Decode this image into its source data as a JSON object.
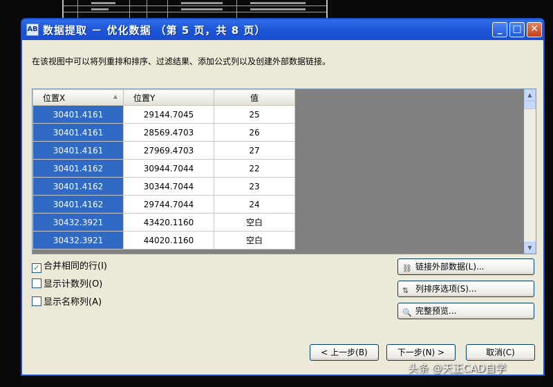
{
  "window": {
    "title": "数据提取 － 优化数据 （第 5 页，共 8 页）",
    "min_glyph": "_",
    "max_glyph": "□",
    "close_glyph": "✕"
  },
  "description": "在该视图中可以将列重排和排序、过滤结果、添加公式列以及创建外部数据链接。",
  "table": {
    "headers": [
      "位置X",
      "位置Y",
      "值"
    ],
    "rows": [
      [
        "30401.4161",
        "29144.7045",
        "25"
      ],
      [
        "30401.4161",
        "28569.4703",
        "26"
      ],
      [
        "30401.4161",
        "27969.4703",
        "27"
      ],
      [
        "30401.4162",
        "30944.7044",
        "22"
      ],
      [
        "30401.4162",
        "30344.7044",
        "23"
      ],
      [
        "30401.4162",
        "29744.7044",
        "24"
      ],
      [
        "30432.3921",
        "43420.1160",
        "空白"
      ],
      [
        "30432.3921",
        "44020.1160",
        "空白"
      ]
    ]
  },
  "options": {
    "merge_rows": {
      "label": "合并相同的行(I)",
      "checked": true
    },
    "show_count": {
      "label": "显示计数列(O)",
      "checked": false
    },
    "show_name": {
      "label": "显示名称列(A)",
      "checked": false
    }
  },
  "buttons": {
    "link_external": "链接外部数据(L)...",
    "sort_options": "列排序选项(S)...",
    "full_preview": "完整预览...",
    "prev": "< 上一步(B)",
    "next": "下一步(N) >",
    "cancel": "取消(C)"
  },
  "watermark": "头条 @天正CAD自学",
  "colors": {
    "titlebar": "#1d55d6",
    "selection": "#316ac5",
    "dialog": "#ece9d8"
  }
}
